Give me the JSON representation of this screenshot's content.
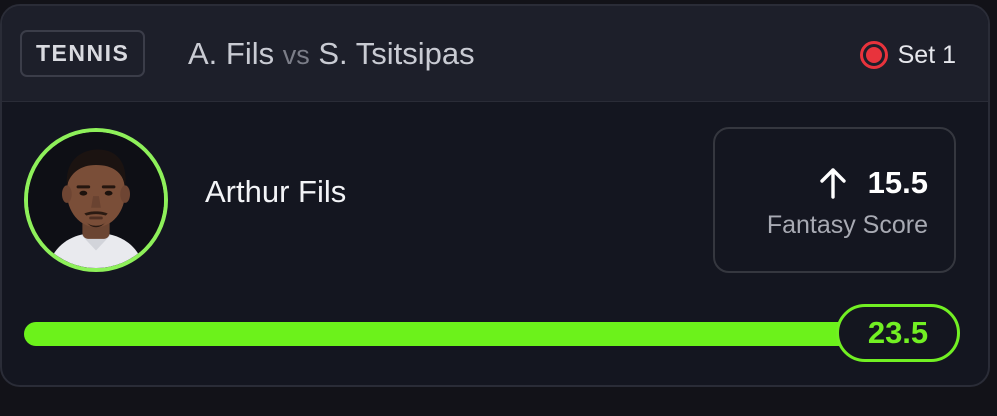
{
  "header": {
    "sport": "TENNIS",
    "player_a": "A. Fils",
    "vs": "vs",
    "player_b": "S. Tsitsipas",
    "status_icon": "live-record-icon",
    "status": "Set 1"
  },
  "player": {
    "name": "Arthur Fils",
    "avatar": "player-photo"
  },
  "projection": {
    "direction_icon": "arrow-up-icon",
    "line": "15.5",
    "label": "Fantasy Score"
  },
  "progress": {
    "current": "23.5",
    "fill_fraction": 1.0
  },
  "colors": {
    "accent": "#6cf21b",
    "live": "#e8333c",
    "card_bg": "#141620",
    "header_bg": "#1d1f2a"
  }
}
